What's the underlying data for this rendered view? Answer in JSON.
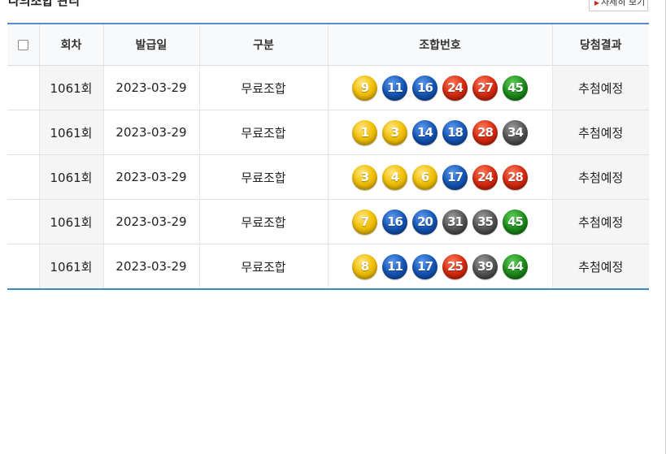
{
  "section": {
    "title": "나의조합 관리",
    "detail_button": "자세히 보기"
  },
  "table": {
    "headers": [
      "회차",
      "발급일",
      "구분",
      "조합번호",
      "당첨결과"
    ],
    "rows": [
      {
        "round": "1061회",
        "date": "2023-03-29",
        "type": "무료조합",
        "numbers": [
          9,
          11,
          16,
          24,
          27,
          45
        ],
        "result": "추첨예정"
      },
      {
        "round": "1061회",
        "date": "2023-03-29",
        "type": "무료조합",
        "numbers": [
          1,
          3,
          14,
          18,
          28,
          34
        ],
        "result": "추첨예정"
      },
      {
        "round": "1061회",
        "date": "2023-03-29",
        "type": "무료조합",
        "numbers": [
          3,
          4,
          6,
          17,
          24,
          28
        ],
        "result": "추첨예정"
      },
      {
        "round": "1061회",
        "date": "2023-03-29",
        "type": "무료조합",
        "numbers": [
          7,
          16,
          20,
          31,
          35,
          45
        ],
        "result": "추첨예정"
      },
      {
        "round": "1061회",
        "date": "2023-03-29",
        "type": "무료조합",
        "numbers": [
          8,
          11,
          17,
          25,
          39,
          44
        ],
        "result": "추첨예정"
      }
    ]
  },
  "ball_colors": {
    "1-10": "#f2c10a",
    "11-20": "#1555b5",
    "21-30": "#d62a10",
    "31-40": "#555555",
    "41-45": "#1d8c1a"
  }
}
